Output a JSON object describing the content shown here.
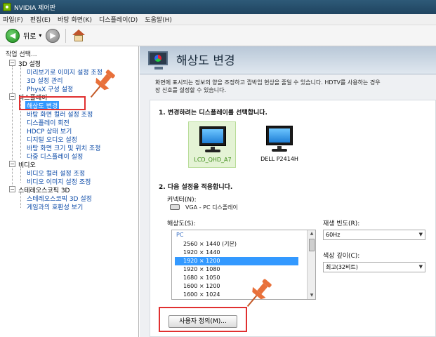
{
  "window": {
    "title": "NVIDIA 제어판"
  },
  "menu": [
    "파일(F)",
    "편집(E)",
    "바탕 화면(K)",
    "디스플레이(D)",
    "도움말(H)"
  ],
  "toolbar": {
    "back_label": "뒤로",
    "caret": "▾"
  },
  "sidebar": {
    "title": "작업 선택...",
    "categories": [
      {
        "label": "3D 설정",
        "items": [
          "미리보기로 이미지 설정 조정",
          "3D 설정 관리",
          "PhysX 구성 설정"
        ]
      },
      {
        "label": "디스플레이",
        "items": [
          "해상도 변경",
          "바탕 화면 컬러 설정 조정",
          "디스플레이 회전",
          "HDCP 상태 보기",
          "디지털 오디오 설정",
          "바탕 화면 크기 및 위치 조정",
          "다중 디스플레이 설정"
        ]
      },
      {
        "label": "비디오",
        "items": [
          "비디오 컬러 설정 조정",
          "비디오 이미지 설정 조정"
        ]
      },
      {
        "label": "스테레오스코픽 3D",
        "items": [
          "스테레오스코픽 3D 설정",
          "게임과의 호환성 보기"
        ]
      }
    ],
    "selected_item": "해상도 변경"
  },
  "page": {
    "title": "해상도 변경",
    "description_line1": "화면에 표시되는 정보의 양을 조정하고 깜박임 현상을 줄일 수 있습니다. HDTV를 사용하는 경우",
    "description_line2": "장 신호를 설정할 수 있습니다."
  },
  "step1": {
    "title": "1. 변경하려는 디스플레이를 선택합니다.",
    "displays": [
      {
        "label": "LCD_QHD_A7",
        "selected": true
      },
      {
        "label": "DELL P2414H",
        "selected": false
      }
    ]
  },
  "step2": {
    "title": "2. 다음 설정을 적용합니다.",
    "connector_label": "커넥터(N):",
    "connector_value": "VGA - PC 디스플레이",
    "resolution_label": "해상도(S):",
    "resolution_group": "PC",
    "resolutions": [
      "2560 × 1440 (기본)",
      "1920 × 1440",
      "1920 × 1200",
      "1920 × 1080",
      "1680 × 1050",
      "1600 × 1200",
      "1600 × 1024"
    ],
    "selected_resolution": "1920 × 1200",
    "refresh_label": "재생 빈도(R):",
    "refresh_value": "60Hz",
    "color_depth_label": "색상 깊이(C):",
    "color_depth_value": "최고(32비트)",
    "custom_button": "사용자 정의(M)..."
  },
  "colors": {
    "accent_red": "#e03030",
    "pin_orange": "#e8703a",
    "selection_blue": "#3399ff",
    "nvidia_green": "#76b900"
  }
}
